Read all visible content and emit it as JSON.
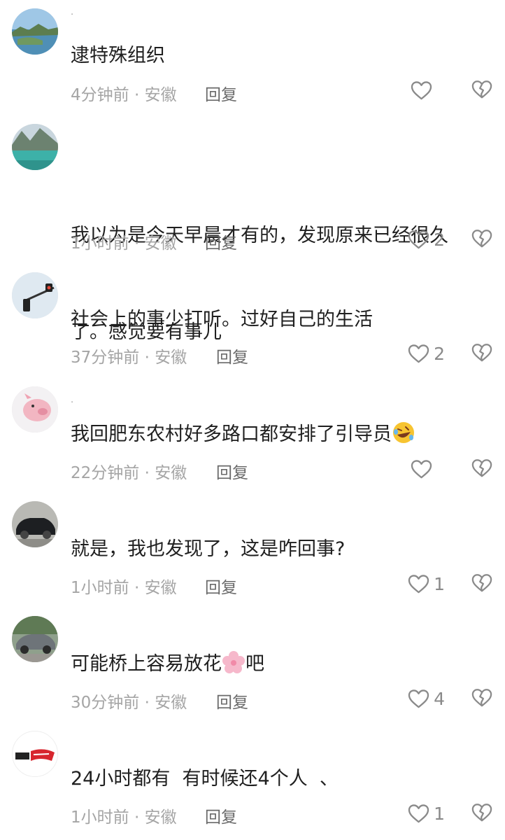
{
  "comments": [
    {
      "nickname": "·",
      "text": "逮特殊组织",
      "time": "4分钟前",
      "location": "安徽",
      "reply": "回复",
      "likes": "",
      "avatar": "lake-landscape-avatar"
    },
    {
      "nickname": "",
      "text_line1": "我以为是今天早晨才有的，发现原来已经很久",
      "text_line2": "了。感觉要有事儿",
      "time": "1小时前",
      "location": "安徽",
      "reply": "回复",
      "likes": "2",
      "avatar": "mountain-lake-avatar"
    },
    {
      "nickname": "",
      "text": "社会上的事少打听。过好自己的生活",
      "time": "37分钟前",
      "location": "安徽",
      "reply": "回复",
      "likes": "2",
      "avatar": "traffic-light-avatar"
    },
    {
      "nickname": "·",
      "text": "我回肥东农村好多路口都安排了引导员",
      "emoji": "rofl-emoji",
      "time": "22分钟前",
      "location": "安徽",
      "reply": "回复",
      "likes": "",
      "avatar": "piglet-avatar"
    },
    {
      "nickname": "",
      "text": "就是，我也发现了，这是咋回事?",
      "time": "1小时前",
      "location": "安徽",
      "reply": "回复",
      "likes": "1",
      "avatar": "black-car-avatar"
    },
    {
      "nickname": "",
      "text_before": "可能桥上容易放花",
      "emoji": "cherry-blossom-emoji",
      "text_after": "吧",
      "time": "30分钟前",
      "location": "安徽",
      "reply": "回复",
      "likes": "4",
      "avatar": "gray-car-avatar"
    },
    {
      "nickname": "",
      "text": "24小时都有  有时候还4个人  、",
      "time": "1小时前",
      "location": "安徽",
      "reply": "回复",
      "likes": "1",
      "avatar": "baiwei-logo-avatar"
    }
  ],
  "meta_separator": " · ",
  "colors": {
    "text": "#1f1f1f",
    "meta": "#a5a5a5",
    "reply": "#6a6a6a",
    "icon": "#8a8a8a"
  },
  "icons": {
    "like": "heart-outline-icon",
    "dislike": "broken-heart-icon"
  }
}
